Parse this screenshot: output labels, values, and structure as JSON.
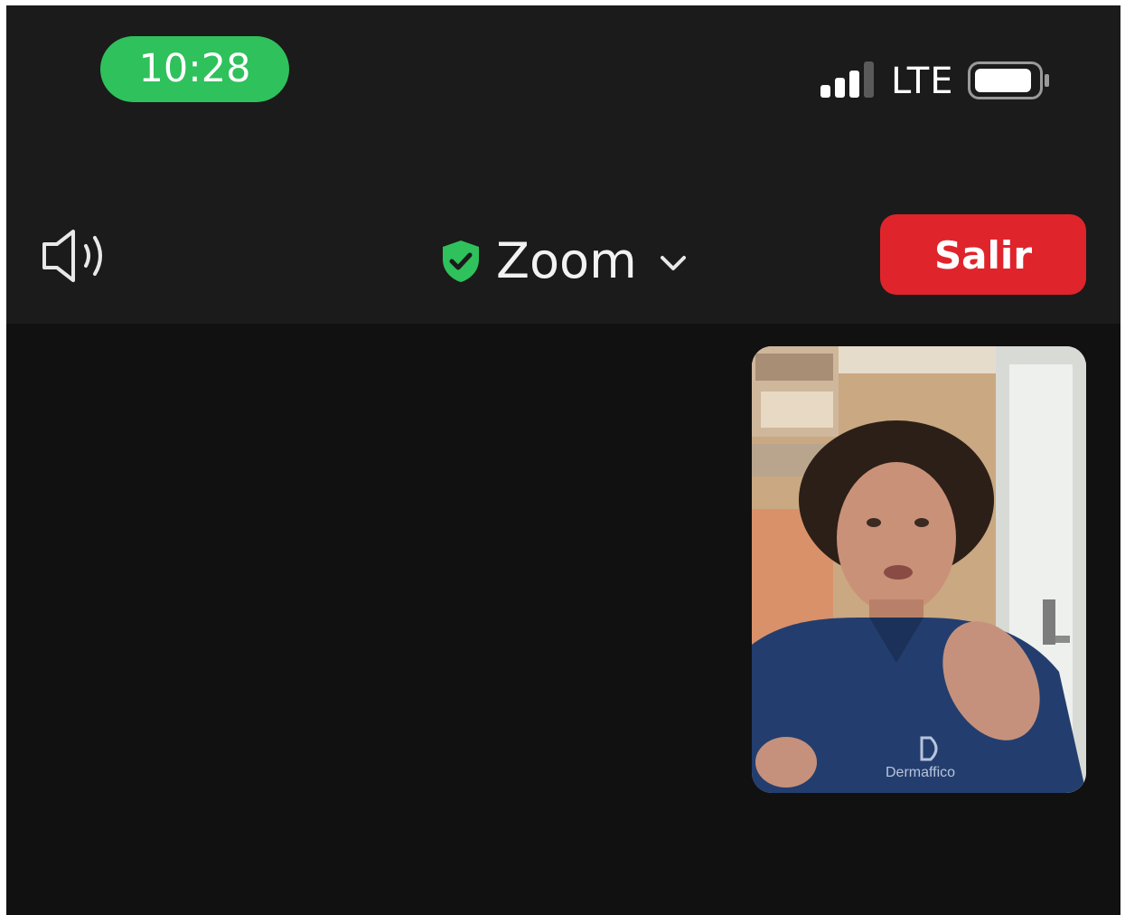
{
  "status_bar": {
    "time": "10:28",
    "network": "LTE",
    "signal_bars_active": 3,
    "signal_bars_total": 4,
    "battery_level": 0.85
  },
  "toolbar": {
    "speaker_icon": "speaker-icon",
    "meeting_title": "Zoom",
    "security_icon": "shield-check-icon",
    "dropdown_icon": "chevron-down-icon",
    "leave_label": "Salir"
  },
  "video": {
    "self_view_shirt_text": "Dermaffico"
  },
  "colors": {
    "time_pill": "#2fc15c",
    "leave_button": "#e0242b",
    "shield": "#2fc15c",
    "background": "#121212"
  }
}
